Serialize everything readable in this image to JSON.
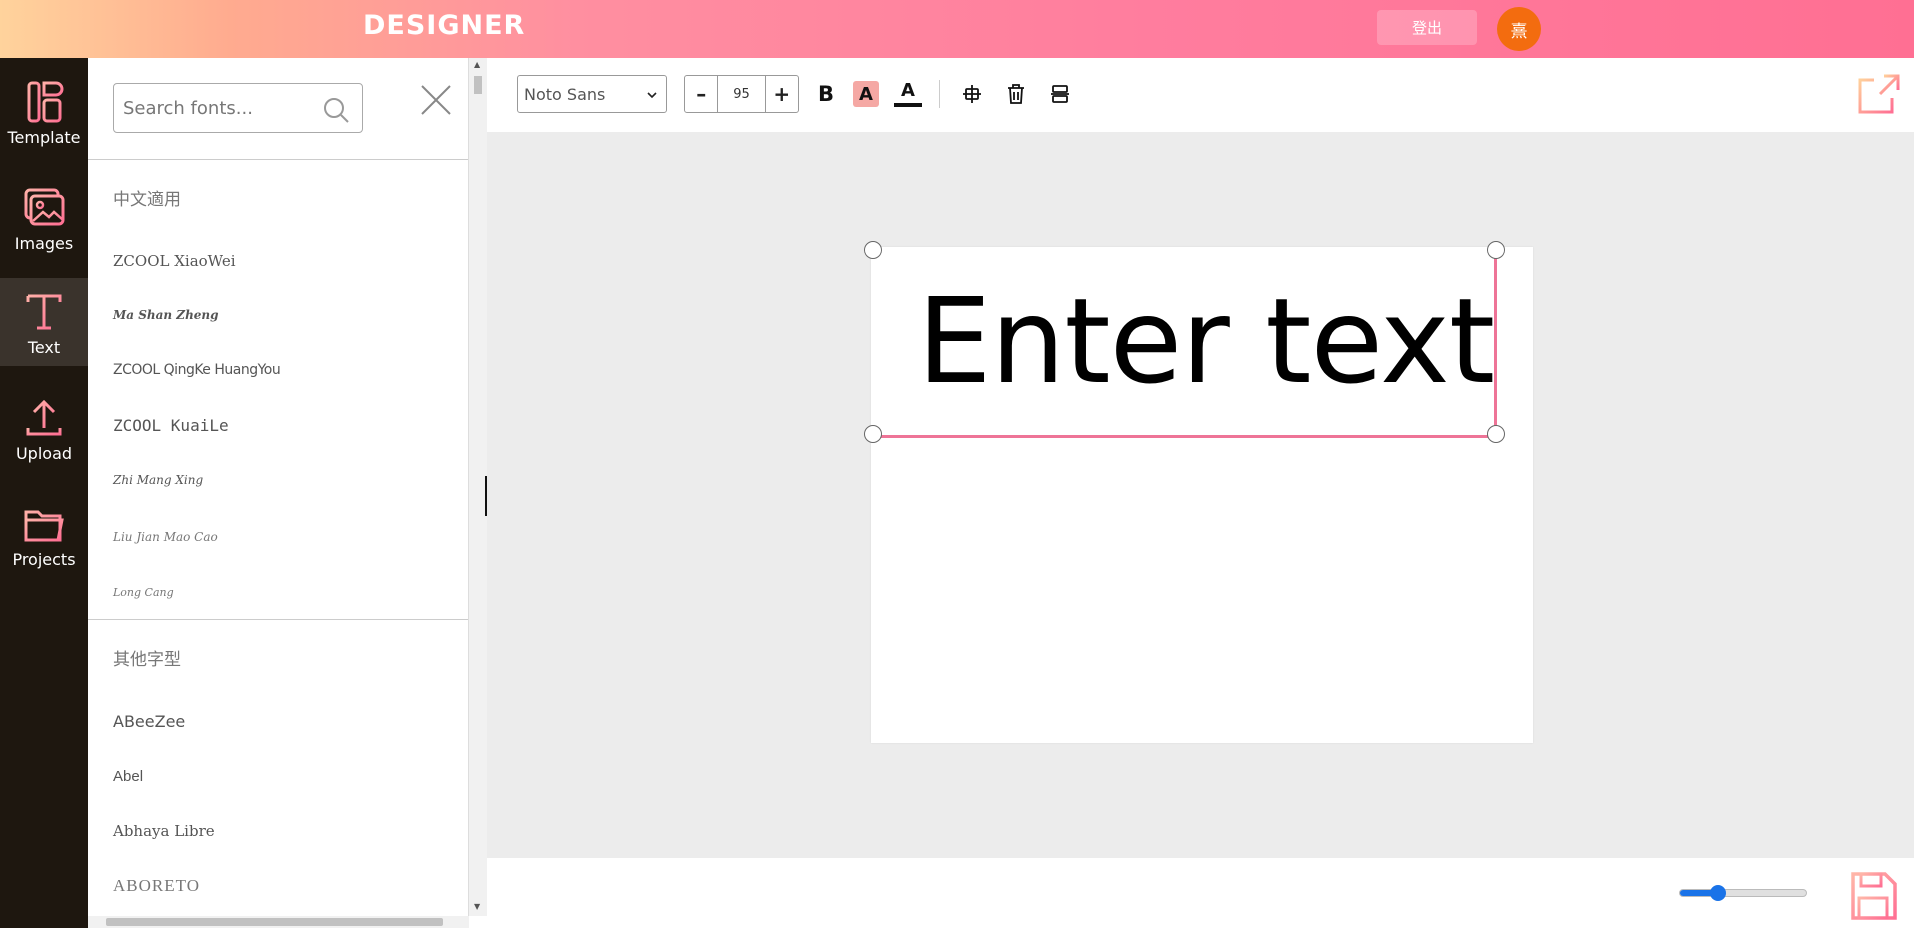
{
  "header": {
    "logo": "DESIGNER",
    "logout_label": "登出",
    "avatar_text": "熹",
    "avatar_color": "#f36c0f"
  },
  "leftnav": {
    "items": [
      {
        "label": "Template",
        "icon": "template-icon"
      },
      {
        "label": "Images",
        "icon": "images-icon"
      },
      {
        "label": "Text",
        "icon": "text-icon",
        "active": true
      },
      {
        "label": "Upload",
        "icon": "upload-icon"
      },
      {
        "label": "Projects",
        "icon": "folder-icon"
      }
    ]
  },
  "fontpanel": {
    "search_placeholder": "Search fonts...",
    "sections": [
      {
        "title": "中文適用",
        "fonts": [
          "ZCOOL XiaoWei",
          "Ma Shan Zheng",
          "ZCOOL QingKe HuangYou",
          "ZCOOL KuaiLe",
          "Zhi Mang Xing",
          "Liu Jian Mao Cao",
          "Long Cang"
        ]
      },
      {
        "title": "其他字型",
        "fonts": [
          "ABeeZee",
          "Abel",
          "Abhaya Libre",
          "ABORETO"
        ]
      }
    ]
  },
  "toolbar": {
    "font_family": "Noto Sans",
    "font_size": "95",
    "minus_label": "–",
    "plus_label": "+",
    "bold_label": "B",
    "highlight_label": "A",
    "color_label": "A"
  },
  "canvas": {
    "text": "Enter text",
    "selection_color": "#ee7497"
  },
  "bottombar": {
    "zoom_fraction": 0.27,
    "accent": "#1a73e8"
  }
}
